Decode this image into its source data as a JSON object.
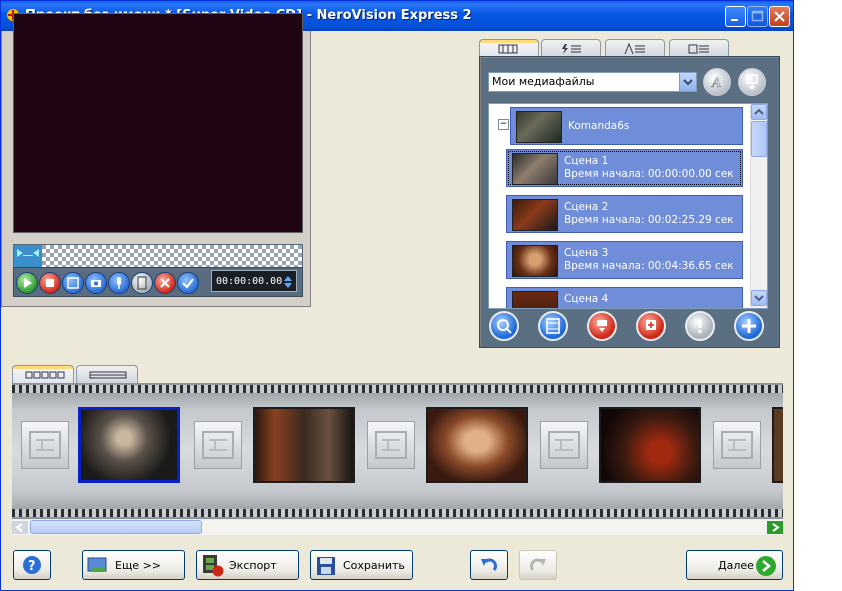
{
  "window": {
    "title": "Проект без имени * [Super Video CD] - NeroVision Express 2"
  },
  "preview": {
    "timecode": "00:00:00.00"
  },
  "media": {
    "dropdown_value": "Мои медиафайлы",
    "folder": {
      "label": "Komanda6s"
    },
    "items": [
      {
        "title": "Сцена 1",
        "start": "Время начала: 00:00:00.00 сек"
      },
      {
        "title": "Сцена 2",
        "start": "Время начала: 00:02:25.29 сек"
      },
      {
        "title": "Сцена 3",
        "start": "Время начала: 00:04:36.65 сек"
      },
      {
        "title": "Сцена 4",
        "start": ""
      }
    ]
  },
  "toolbar": {
    "help_label": "",
    "more_label": "Еще >>",
    "export_label": "Экспорт",
    "save_label": "Сохранить",
    "next_label": "Далее"
  },
  "colors": {
    "title_bar": "#0756e4",
    "media_selection": "#6f8dd8",
    "selected_scene_border": "#0a1fc8"
  }
}
